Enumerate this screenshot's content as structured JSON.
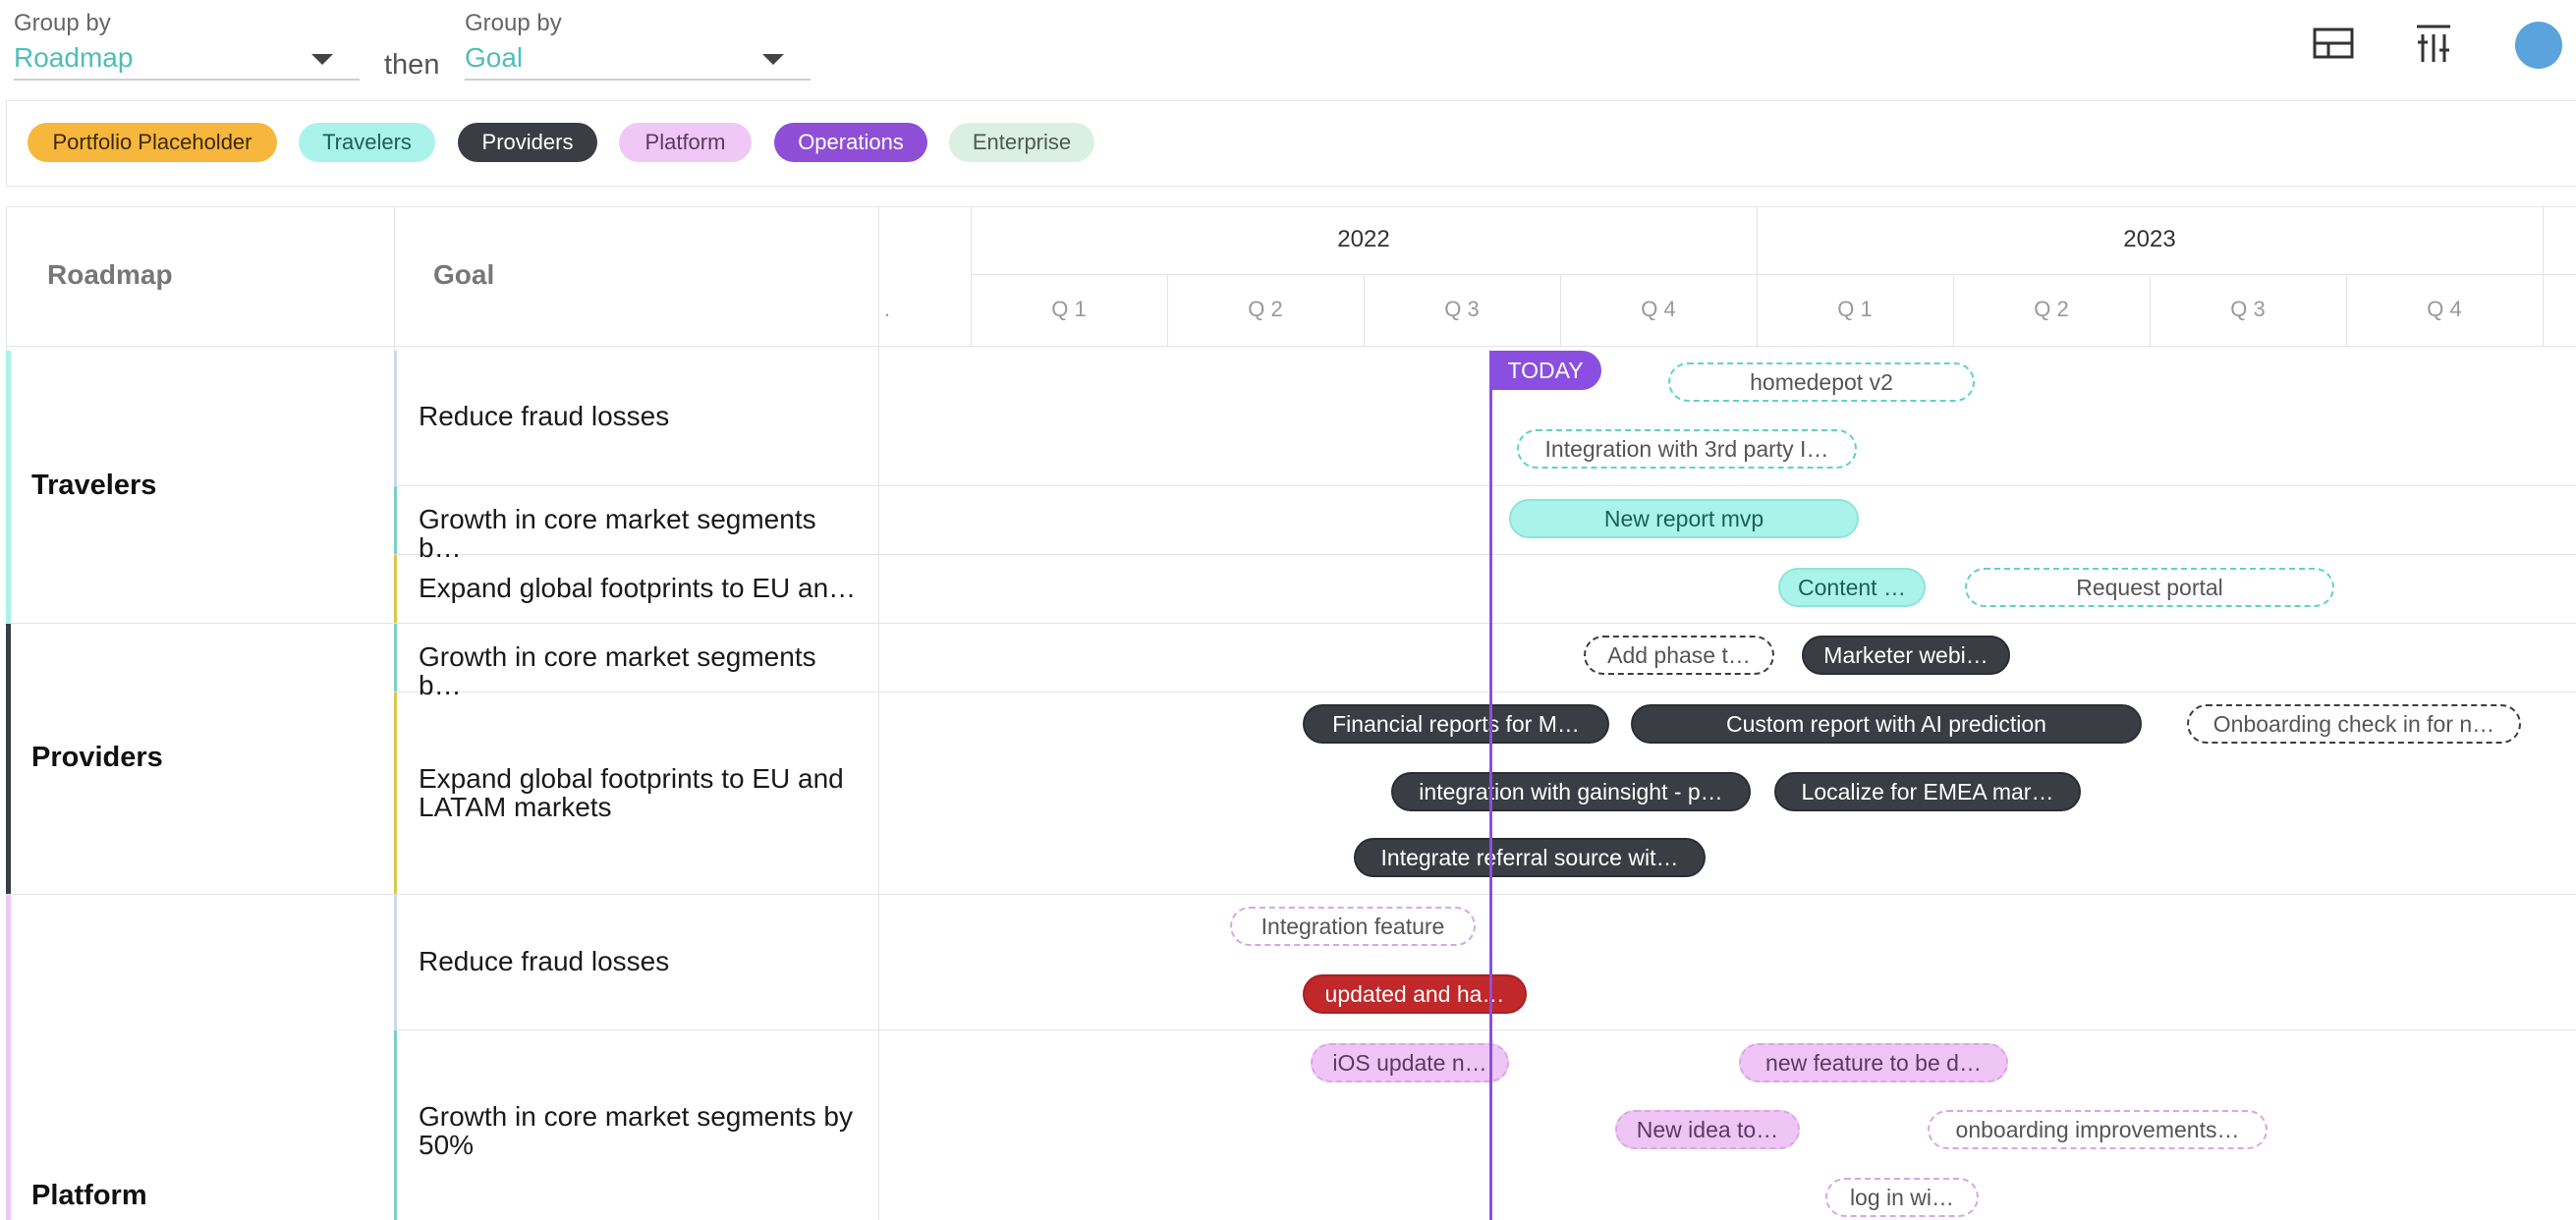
{
  "controls": {
    "group_by_1": {
      "label": "Group by",
      "value": "Roadmap"
    },
    "then": "then",
    "group_by_2": {
      "label": "Group by",
      "value": "Goal"
    }
  },
  "filters": [
    {
      "label": "Portfolio Placeholder",
      "bg": "#f6b73c",
      "fg": "#3a2a00"
    },
    {
      "label": "Travelers",
      "bg": "#a9f3ea",
      "fg": "#1e5e58"
    },
    {
      "label": "Providers",
      "bg": "#3a3d43",
      "fg": "#ffffff"
    },
    {
      "label": "Platform",
      "bg": "#f0c8f5",
      "fg": "#5a3a60"
    },
    {
      "label": "Operations",
      "bg": "#8e4fd6",
      "fg": "#ffffff"
    },
    {
      "label": "Enterprise",
      "bg": "#dcefe3",
      "fg": "#4d5a52"
    }
  ],
  "table": {
    "roadmap_header": "Roadmap",
    "goal_header": "Goal",
    "years": [
      "2022",
      "2023"
    ],
    "quarters": [
      "Q 1",
      "Q 2",
      "Q 3",
      "Q 4",
      "Q 1",
      "Q 2",
      "Q 3",
      "Q 4"
    ],
    "pre_quarter": "."
  },
  "roadmaps": [
    {
      "name": "Travelers",
      "color": "#a9f3ea"
    },
    {
      "name": "Providers",
      "color": "#3a3d43"
    },
    {
      "name": "Platform",
      "color": "#f0c8f5"
    }
  ],
  "goals": [
    {
      "text": "Reduce fraud losses",
      "bar": "#c9d9f3"
    },
    {
      "text": "Growth in core market segments b…",
      "bar": "#79d1c4"
    },
    {
      "text": "Expand global footprints to EU an…",
      "bar": "#d7c74b"
    },
    {
      "text": "Growth in core market segments b…",
      "bar": "#79d1c4"
    },
    {
      "text": "Expand global footprints to EU and LATAM markets",
      "bar": "#d7c74b"
    },
    {
      "text": "Reduce fraud losses",
      "bar": "#c9d9f3"
    },
    {
      "text": "Growth in core market segments by 50%",
      "bar": "#79d1c4"
    }
  ],
  "today_label": "TODAY",
  "items": [
    {
      "label": "homedepot v2",
      "style": "dash-teal"
    },
    {
      "label": "Integration with 3rd party I…",
      "style": "dash-teal"
    },
    {
      "label": "New report mvp",
      "style": "solid-teal"
    },
    {
      "label": "Content …",
      "style": "solid-teal"
    },
    {
      "label": "Request portal",
      "style": "dash-teal"
    },
    {
      "label": "Add phase t…",
      "style": "dash-dark"
    },
    {
      "label": "Marketer webi…",
      "style": "solid-dark"
    },
    {
      "label": "Financial reports for M…",
      "style": "solid-dark"
    },
    {
      "label": "Custom report with AI prediction",
      "style": "solid-dark"
    },
    {
      "label": "Onboarding check in for n…",
      "style": "dash-dark"
    },
    {
      "label": "integration with gainsight - p…",
      "style": "solid-dark"
    },
    {
      "label": "Localize for EMEA mar…",
      "style": "solid-dark"
    },
    {
      "label": "Integrate referral source wit…",
      "style": "solid-dark"
    },
    {
      "label": "Integration feature",
      "style": "dash-pink"
    },
    {
      "label": "updated and ha…",
      "style": "solid-red"
    },
    {
      "label": "iOS update n…",
      "style": "solid-pink"
    },
    {
      "label": "new feature to be d…",
      "style": "solid-pink"
    },
    {
      "label": "New idea to…",
      "style": "solid-pink"
    },
    {
      "label": "onboarding improvements…",
      "style": "dash-pink"
    },
    {
      "label": "log in wi…",
      "style": "dash-pink"
    }
  ],
  "icons": {
    "layout": "layout-icon",
    "columns": "column-settings-icon",
    "avatar": "user-avatar"
  }
}
